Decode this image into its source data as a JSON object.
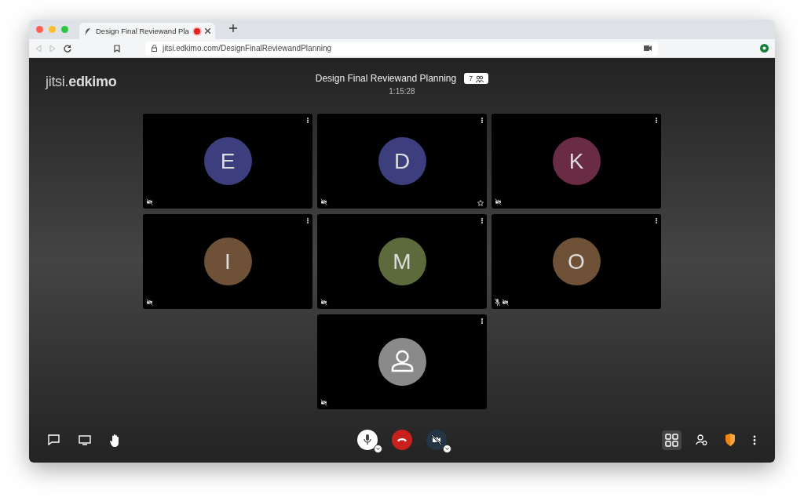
{
  "browser": {
    "tab_title": "Design Final Reviewand Pla",
    "recording": true,
    "url": "jitsi.edkimo.com/DesignFinalReviewandPlanning"
  },
  "header": {
    "logo": "jitsi.**edkimo**",
    "title": "Design Final Reviewand Planning",
    "timer": "1:15:28",
    "participant_count": "7"
  },
  "tiles": [
    {
      "kind": "initial",
      "initial": "E",
      "color": "#3d3e7e",
      "mic_muted": false,
      "camera_muted": true,
      "starred": false
    },
    {
      "kind": "initial",
      "initial": "D",
      "color": "#3d3e7e",
      "mic_muted": false,
      "camera_muted": true,
      "starred": true
    },
    {
      "kind": "initial",
      "initial": "K",
      "color": "#6a2b45",
      "mic_muted": false,
      "camera_muted": true,
      "starred": false
    },
    {
      "kind": "initial",
      "initial": "I",
      "color": "#6e5136",
      "mic_muted": false,
      "camera_muted": true,
      "starred": false
    },
    {
      "kind": "initial",
      "initial": "M",
      "color": "#5d6b3c",
      "mic_muted": false,
      "camera_muted": true,
      "starred": false
    },
    {
      "kind": "initial",
      "initial": "O",
      "color": "#6e5136",
      "mic_muted": true,
      "camera_muted": true,
      "starred": false
    },
    {
      "kind": "avatar",
      "mic_muted": false,
      "camera_muted": true,
      "starred": false
    }
  ],
  "toolbar": {
    "mic_muted": false,
    "camera_muted": true,
    "tile_view": true
  }
}
